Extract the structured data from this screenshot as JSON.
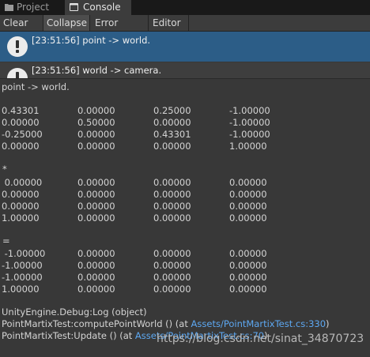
{
  "tabs": [
    {
      "label": "Project",
      "icon": "folder-icon"
    },
    {
      "label": "Console",
      "icon": "console-icon"
    }
  ],
  "toolbar": {
    "clear": "Clear",
    "collapse": "Collapse",
    "error_pause": "Error Pause",
    "editor": "Editor"
  },
  "log_entries": [
    {
      "text": "[23:51:56] point -> world.",
      "icon": "info-icon"
    },
    {
      "text": "[23:51:56] world -> camera.",
      "icon": "info-icon"
    }
  ],
  "detail": {
    "header": "point -> world.",
    "matrix1": [
      [
        "0.43301",
        "0.00000",
        "0.25000",
        "-1.00000"
      ],
      [
        "0.00000",
        "0.50000",
        "0.00000",
        "-1.00000"
      ],
      [
        "-0.25000",
        "0.00000",
        "0.43301",
        "-1.00000"
      ],
      [
        "0.00000",
        "0.00000",
        "0.00000",
        "1.00000"
      ]
    ],
    "op1": "*",
    "matrix2": [
      [
        " 0.00000",
        "0.00000",
        "0.00000",
        "0.00000"
      ],
      [
        "0.00000",
        "0.00000",
        "0.00000",
        "0.00000"
      ],
      [
        "0.00000",
        "0.00000",
        "0.00000",
        "0.00000"
      ],
      [
        "1.00000",
        "0.00000",
        "0.00000",
        "0.00000"
      ]
    ],
    "op2": "=",
    "matrix3": [
      [
        " -1.00000",
        "0.00000",
        "0.00000",
        "0.00000"
      ],
      [
        "-1.00000",
        "0.00000",
        "0.00000",
        "0.00000"
      ],
      [
        "-1.00000",
        "0.00000",
        "0.00000",
        "0.00000"
      ],
      [
        "1.00000",
        "0.00000",
        "0.00000",
        "0.00000"
      ]
    ],
    "stack": [
      {
        "prefix": "UnityEngine.Debug:Log (object)",
        "link": "",
        "suffix": ""
      },
      {
        "prefix": "PointMartixTest:computePointWorld () (at ",
        "link": "Assets/PointMartixTest.cs:330",
        "suffix": ")"
      },
      {
        "prefix": "PointMartixTest:Update () (at ",
        "link": "Assets/PointMartixTest.cs:70",
        "suffix": ")"
      }
    ]
  },
  "watermark": "https://blog.csdn.net/sinat_34870723"
}
